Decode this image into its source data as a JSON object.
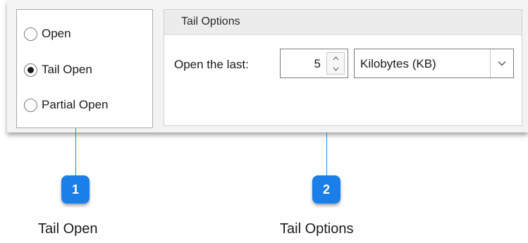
{
  "radio_group": {
    "options": [
      {
        "label": "Open",
        "selected": false
      },
      {
        "label": "Tail Open",
        "selected": true
      },
      {
        "label": "Partial Open",
        "selected": false
      }
    ]
  },
  "tail_options": {
    "title": "Tail Options",
    "open_last_label": "Open the last:",
    "spinner_value": "5",
    "unit_selected": "Kilobytes (KB)"
  },
  "callouts": [
    {
      "number": "1",
      "label": "Tail Open"
    },
    {
      "number": "2",
      "label": "Tail Options"
    }
  ],
  "colors": {
    "accent": "#1a7fe8",
    "line": "#1e8bf0"
  },
  "icons": {
    "spinner_up": "caret-up-icon",
    "spinner_down": "caret-down-icon",
    "dropdown": "chevron-down-icon"
  }
}
